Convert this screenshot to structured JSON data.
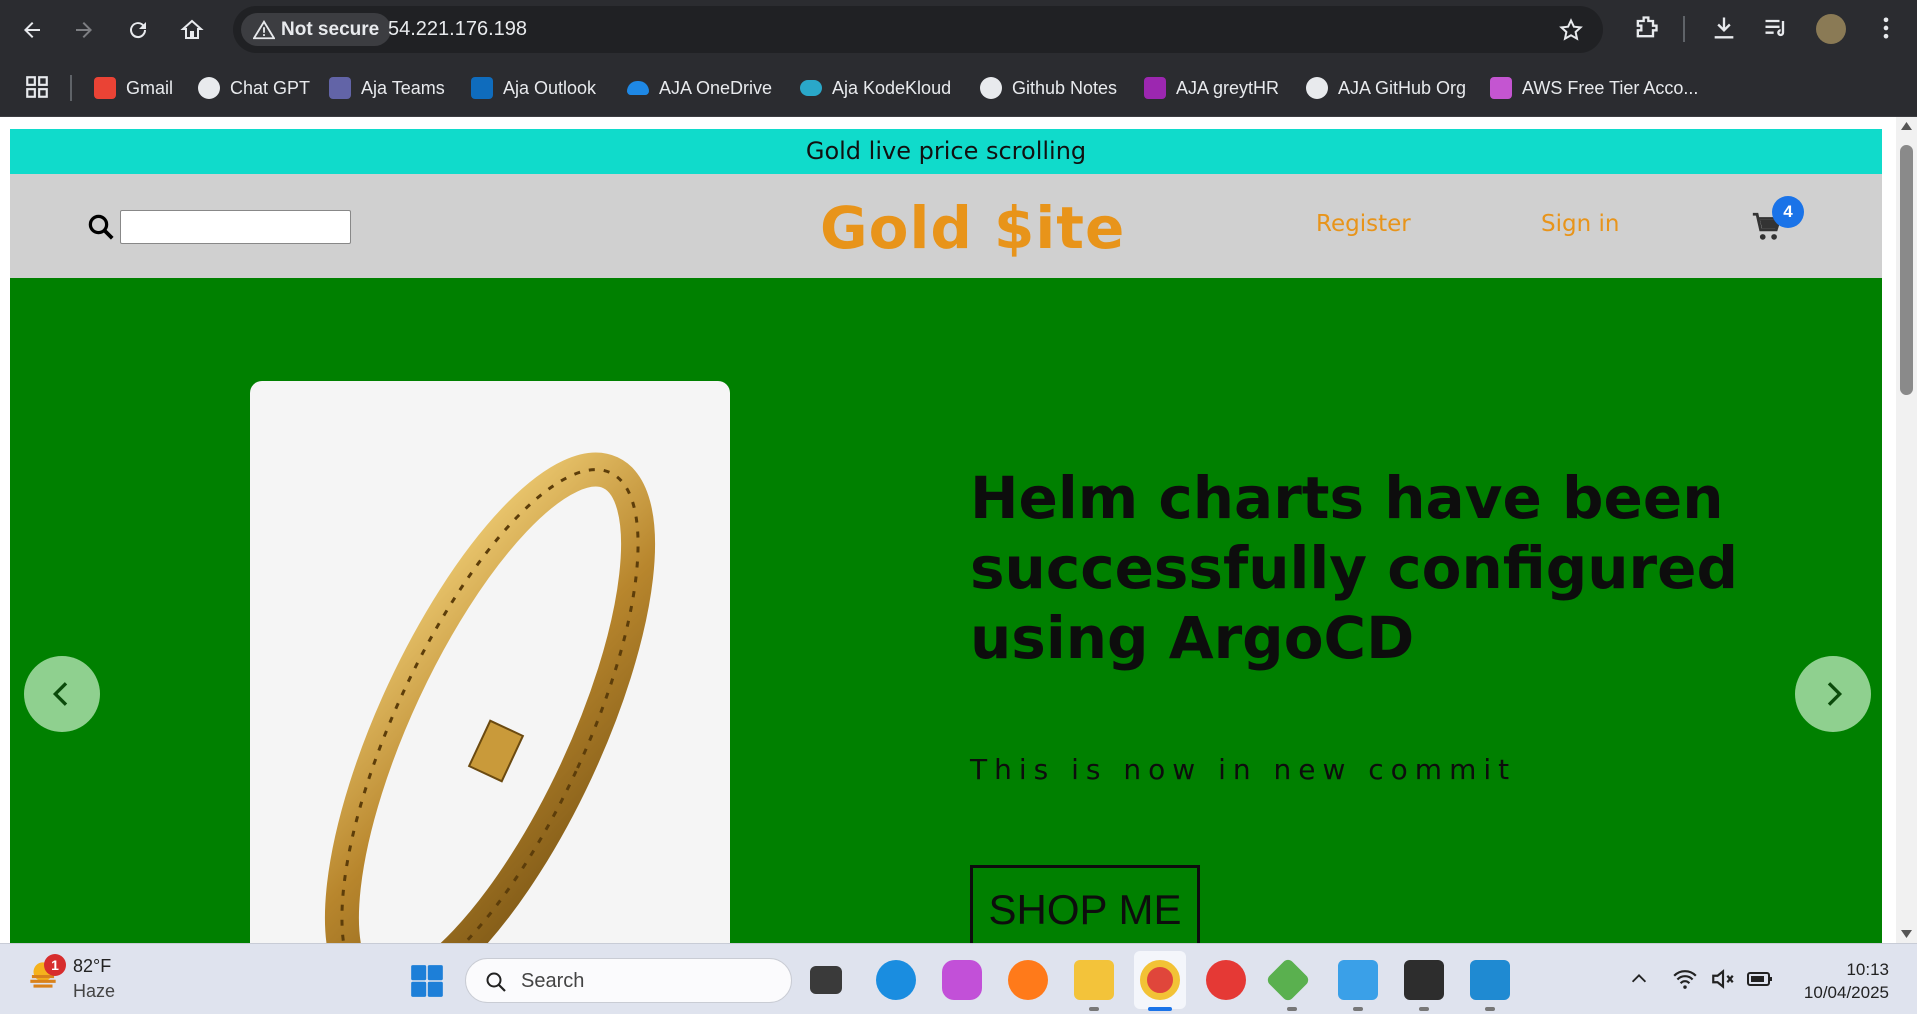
{
  "browser": {
    "security_label": "Not secure",
    "url": "54.221.176.198"
  },
  "bookmarks": [
    {
      "label": "Gmail",
      "icon": "gmail-icon"
    },
    {
      "label": "Chat GPT",
      "icon": "chatgpt-icon"
    },
    {
      "label": "Aja Teams",
      "icon": "teams-icon"
    },
    {
      "label": "Aja Outlook",
      "icon": "outlook-icon"
    },
    {
      "label": "AJA OneDrive",
      "icon": "onedrive-icon"
    },
    {
      "label": "Aja KodeKloud",
      "icon": "kodekloud-icon"
    },
    {
      "label": "Github Notes",
      "icon": "github-icon"
    },
    {
      "label": "AJA greytHR",
      "icon": "greythr-icon"
    },
    {
      "label": "AJA GitHub Org",
      "icon": "github-icon"
    },
    {
      "label": "AWS Free Tier Acco...",
      "icon": "aws-icon"
    }
  ],
  "page": {
    "ticker": "Gold live price scrolling",
    "logo": "Gold $ite",
    "register": "Register",
    "signin": "Sign in",
    "cart_count": "4",
    "headline": "Helm charts have been successfully configured using ArgoCD",
    "subtext": "This is now in new commit",
    "shop_button": "SHOP ME"
  },
  "taskbar": {
    "weather_temp": "82°F",
    "weather_desc": "Haze",
    "notification_count": "1",
    "search_placeholder": "Search",
    "time": "10:13",
    "date": "10/04/2025"
  },
  "colors": {
    "ticker_bg": "#10dbcb",
    "header_bg": "#d0d0d0",
    "hero_bg": "#008000",
    "brand": "#e8941a"
  }
}
